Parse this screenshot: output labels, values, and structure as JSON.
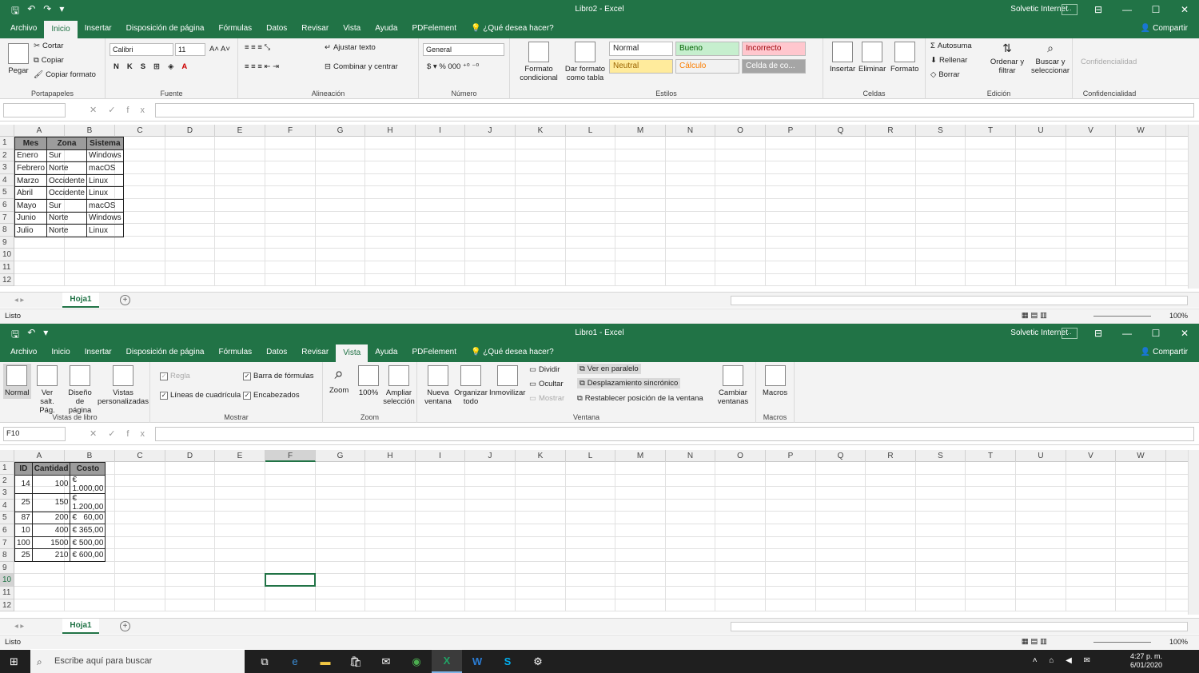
{
  "app": "Excel",
  "user": "Solvetic Internet",
  "share_label": "Compartir",
  "tell_me": "¿Qué desea hacer?",
  "columns": [
    "A",
    "B",
    "C",
    "D",
    "E",
    "F",
    "G",
    "H",
    "I",
    "J",
    "K",
    "L",
    "M",
    "N",
    "O",
    "P",
    "Q",
    "R",
    "S",
    "T",
    "U",
    "V",
    "W"
  ],
  "rows": [
    "1",
    "2",
    "3",
    "4",
    "5",
    "6",
    "7",
    "8",
    "9",
    "10",
    "11",
    "12"
  ],
  "tabs": [
    "Archivo",
    "Inicio",
    "Insertar",
    "Disposición de página",
    "Fórmulas",
    "Datos",
    "Revisar",
    "Vista",
    "Ayuda",
    "PDFelement"
  ],
  "win1": {
    "title": "Libro2  -  Excel",
    "active_tab": "Inicio",
    "namebox": "",
    "status": "Listo",
    "zoom": "100%",
    "sheet": "Hoja1",
    "ribbon": {
      "portapapeles": {
        "pegar": "Pegar",
        "cortar": "Cortar",
        "copiar": "Copiar",
        "copiar_formato": "Copiar formato",
        "label": "Portapapeles"
      },
      "fuente": {
        "font": "Calibri",
        "size": "11",
        "label": "Fuente"
      },
      "alineacion": {
        "ajustar": "Ajustar texto",
        "combinar": "Combinar y centrar",
        "label": "Alineación"
      },
      "numero": {
        "format": "General",
        "label": "Número"
      },
      "estilos": {
        "formato_condicional": "Formato condicional",
        "dar_formato": "Dar formato como tabla",
        "label": "Estilos",
        "cells": [
          {
            "text": "Normal",
            "bg": "#ffffff",
            "fg": "#222222"
          },
          {
            "text": "Bueno",
            "bg": "#c6efce",
            "fg": "#006100"
          },
          {
            "text": "Incorrecto",
            "bg": "#ffc7ce",
            "fg": "#9c0006"
          },
          {
            "text": "Neutral",
            "bg": "#ffeb9c",
            "fg": "#9c6500"
          },
          {
            "text": "Cálculo",
            "bg": "#f2f2f2",
            "fg": "#fa7d00"
          },
          {
            "text": "Celda de co...",
            "bg": "#a5a5a5",
            "fg": "#ffffff"
          }
        ]
      },
      "celdas": {
        "insertar": "Insertar",
        "eliminar": "Eliminar",
        "formato": "Formato",
        "label": "Celdas"
      },
      "edicion": {
        "autosuma": "Autosuma",
        "rellenar": "Rellenar",
        "borrar": "Borrar",
        "ordenar": "Ordenar y filtrar",
        "buscar": "Buscar y seleccionar",
        "label": "Edición"
      },
      "confidencialidad": {
        "btn": "Confidencialidad",
        "label": "Confidencialidad"
      }
    },
    "table": {
      "header": [
        "Mes",
        "Zona",
        "Sistema"
      ],
      "rows": [
        [
          "Enero",
          "Sur",
          "Windows"
        ],
        [
          "Febrero",
          "Norte",
          "macOS"
        ],
        [
          "Marzo",
          "Occidente",
          "Linux"
        ],
        [
          "Abril",
          "Occidente",
          "Linux"
        ],
        [
          "Mayo",
          "Sur",
          "macOS"
        ],
        [
          "Junio",
          "Norte",
          "Windows"
        ],
        [
          "Julio",
          "Norte",
          "Linux"
        ]
      ]
    }
  },
  "win2": {
    "title": "Libro1  -  Excel",
    "active_tab": "Vista",
    "namebox": "F10",
    "status": "Listo",
    "zoom": "100%",
    "sheet": "Hoja1",
    "ribbon": {
      "vistas": {
        "normal": "Normal",
        "ver_salt": "Ver salt. Pág.",
        "diseno": "Diseño de página",
        "personalizadas": "Vistas personalizadas",
        "label": "Vistas de libro"
      },
      "mostrar": {
        "regla": "Regla",
        "barra": "Barra de fórmulas",
        "lineas": "Líneas de cuadrícula",
        "encabezados": "Encabezados",
        "label": "Mostrar"
      },
      "zoom": {
        "zoom": "Zoom",
        "cien": "100%",
        "ampliar": "Ampliar selección",
        "label": "Zoom"
      },
      "ventana": {
        "nueva": "Nueva ventana",
        "organizar": "Organizar todo",
        "inmovilizar": "Inmovilizar",
        "dividir": "Dividir",
        "ocultar": "Ocultar",
        "mostrar": "Mostrar",
        "paralelo": "Ver en paralelo",
        "sincronico": "Desplazamiento sincrónico",
        "restablecer": "Restablecer posición de la ventana",
        "cambiar": "Cambiar ventanas",
        "label": "Ventana"
      },
      "macros": {
        "macros": "Macros",
        "label": "Macros"
      }
    },
    "table": {
      "header": [
        "ID",
        "Cantidad",
        "Costo"
      ],
      "rows": [
        [
          "14",
          "100",
          "€",
          "1.000,00"
        ],
        [
          "25",
          "150",
          "€",
          "1.200,00"
        ],
        [
          "87",
          "200",
          "€",
          "60,00"
        ],
        [
          "10",
          "400",
          "€",
          "365,00"
        ],
        [
          "100",
          "1500",
          "€",
          "500,00"
        ],
        [
          "25",
          "210",
          "€",
          "600,00"
        ]
      ]
    }
  },
  "taskbar": {
    "search": "Escribe aquí para buscar",
    "time": "4:27 p. m.",
    "date": "6/01/2020"
  }
}
